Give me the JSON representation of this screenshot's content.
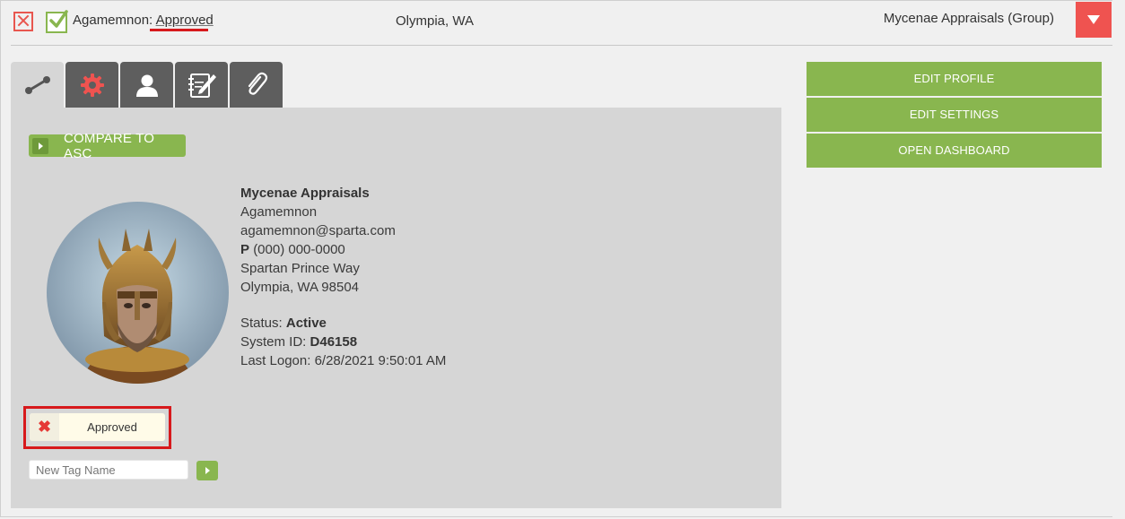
{
  "header": {
    "user_name": "Agamemnon:",
    "status": "Approved",
    "location": "Olympia, WA",
    "group": "Mycenae Appraisals (Group)"
  },
  "tabs": [
    {
      "icon": "link-icon",
      "active": true
    },
    {
      "icon": "gear-icon",
      "active": false
    },
    {
      "icon": "user-icon",
      "active": false
    },
    {
      "icon": "notes-icon",
      "active": false
    },
    {
      "icon": "paperclip-icon",
      "active": false
    }
  ],
  "compare": {
    "label": "COMPARE TO ASC"
  },
  "profile": {
    "company": "Mycenae Appraisals",
    "name": "Agamemnon",
    "email": "agamemnon@sparta.com",
    "phone_label": "P",
    "phone": "(000) 000-0000",
    "address1": "Spartan Prince Way",
    "address2": "Olympia, WA 98504",
    "status_label": "Status:",
    "status_value": "Active",
    "system_id_label": "System ID:",
    "system_id_value": "D46158",
    "last_logon_label": "Last Logon:",
    "last_logon_value": "6/28/2021 9:50:01 AM"
  },
  "tags": {
    "items": [
      {
        "remove_icon": "✖",
        "label": "Approved"
      }
    ],
    "new_placeholder": "New Tag Name"
  },
  "actions": {
    "edit_profile": "EDIT PROFILE",
    "edit_settings": "EDIT SETTINGS",
    "open_dashboard": "OPEN DASHBOARD"
  },
  "colors": {
    "accent_green": "#89b64f",
    "alert_red": "#ef5350",
    "tab_gray": "#5e5e5e",
    "panel_gray": "#d6d6d6"
  }
}
